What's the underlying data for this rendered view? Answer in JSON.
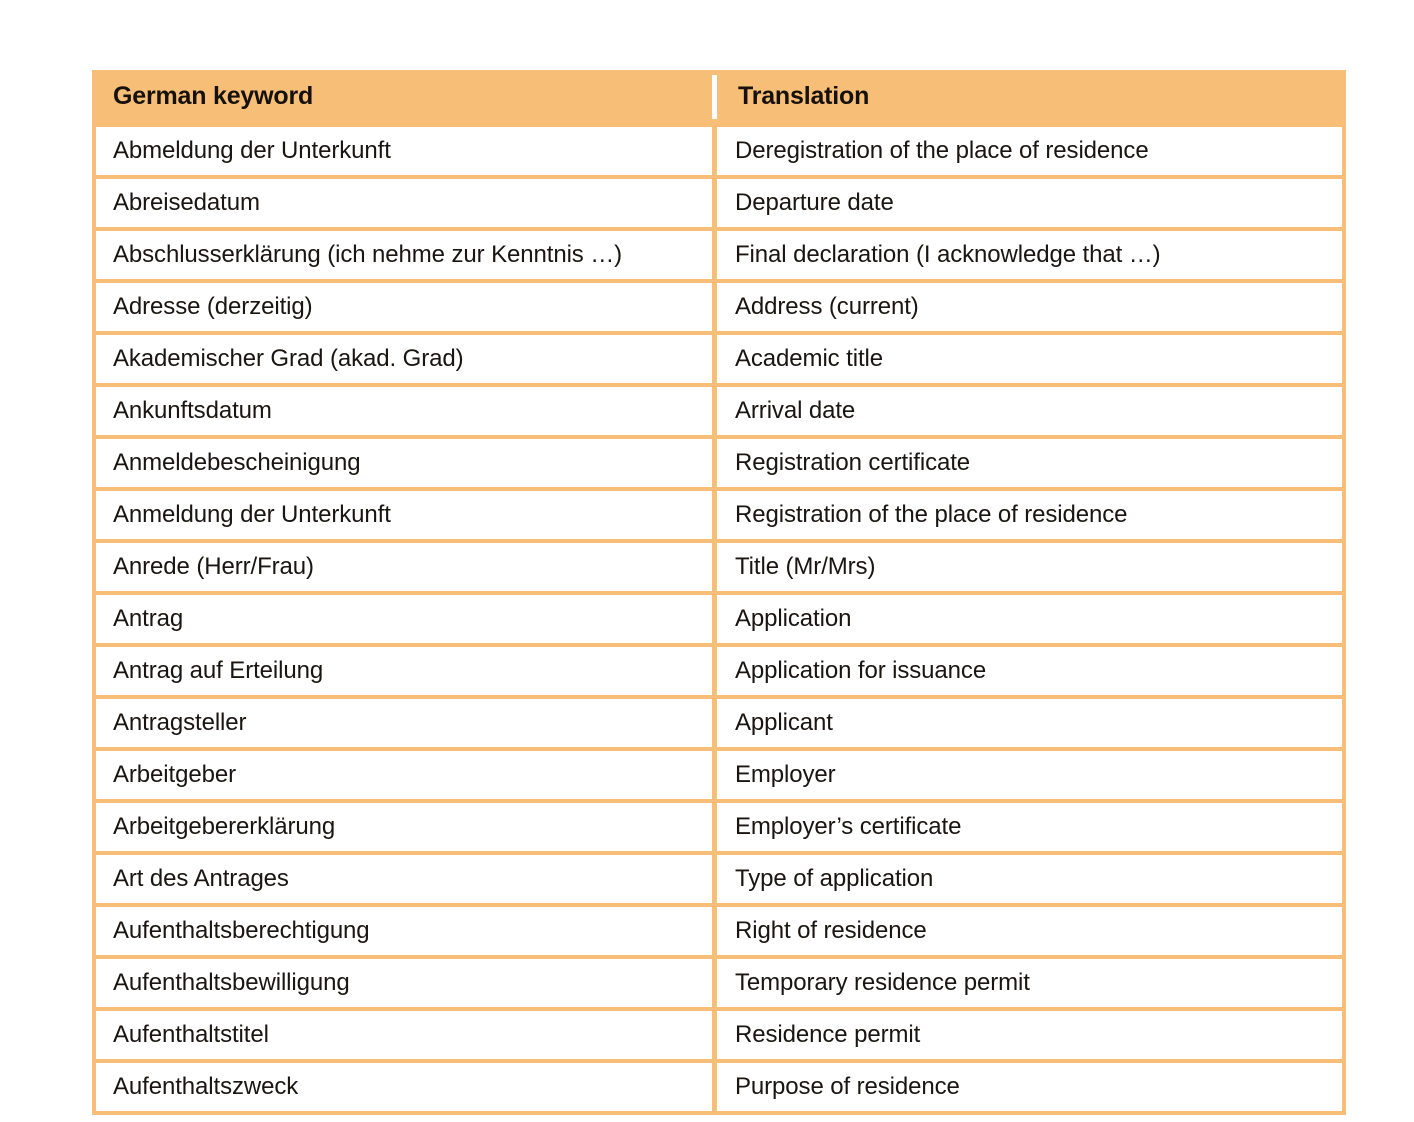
{
  "table": {
    "columns": [
      {
        "key": "german",
        "label": "German keyword"
      },
      {
        "key": "translation",
        "label": "Translation"
      }
    ],
    "colors": {
      "header_background": "#F7BE77",
      "grid_line": "#F7BE77",
      "cell_background": "#FFFFFF",
      "text": "#1A1512",
      "header_divider": "#FFFFFF"
    },
    "rows": [
      {
        "german": "Abmeldung der Unterkunft",
        "translation": "Deregistration of the place of residence"
      },
      {
        "german": "Abreisedatum",
        "translation": "Departure date"
      },
      {
        "german": "Abschlusserklärung (ich nehme zur Kenntnis …)",
        "translation": "Final declaration (I acknowledge that …)"
      },
      {
        "german": "Adresse (derzeitig)",
        "translation": "Address (current)"
      },
      {
        "german": "Akademischer Grad (akad. Grad)",
        "translation": "Academic title"
      },
      {
        "german": "Ankunftsdatum",
        "translation": "Arrival date"
      },
      {
        "german": "Anmeldebescheinigung",
        "translation": "Registration certificate"
      },
      {
        "german": "Anmeldung der Unterkunft",
        "translation": "Registration of the place of residence"
      },
      {
        "german": "Anrede (Herr/Frau)",
        "translation": "Title (Mr/Mrs)"
      },
      {
        "german": "Antrag",
        "translation": "Application"
      },
      {
        "german": "Antrag auf Erteilung",
        "translation": "Application for issuance"
      },
      {
        "german": "Antragsteller",
        "translation": "Applicant"
      },
      {
        "german": "Arbeitgeber",
        "translation": "Employer"
      },
      {
        "german": "Arbeitgebererklärung",
        "translation": "Employer’s certificate"
      },
      {
        "german": "Art des Antrages",
        "translation": "Type of application"
      },
      {
        "german": "Aufenthaltsberechtigung",
        "translation": "Right of residence"
      },
      {
        "german": "Aufenthaltsbewilligung",
        "translation": "Temporary residence permit"
      },
      {
        "german": "Aufenthaltstitel",
        "translation": "Residence permit"
      },
      {
        "german": "Aufenthaltszweck",
        "translation": "Purpose of residence"
      }
    ]
  }
}
